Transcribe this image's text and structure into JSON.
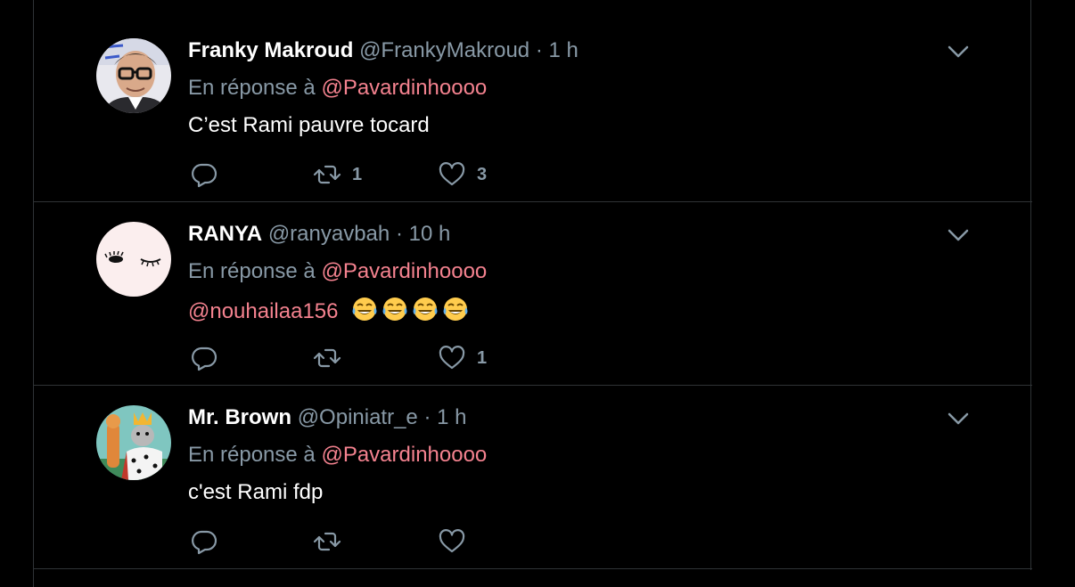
{
  "reply_prefix": "En réponse à",
  "tweets": [
    {
      "name": "Franky Makroud",
      "handle": "@FrankyMakroud",
      "dot": "·",
      "time": "1 h",
      "reply_to": "@Pavardinhoooo",
      "text": "C’est Rami pauvre tocard",
      "text_mention": "",
      "retweets": "1",
      "likes": "3",
      "avatar": "man-glasses-avatar"
    },
    {
      "name": "RANYA",
      "handle": "@ranyavbah",
      "dot": "·",
      "time": "10 h",
      "reply_to": "@Pavardinhoooo",
      "text": "",
      "text_mention": "@nouhailaa156",
      "emojis": [
        "face-with-tears-of-joy",
        "face-with-tears-of-joy",
        "face-with-tears-of-joy",
        "face-with-tears-of-joy"
      ],
      "retweets": "",
      "likes": "1",
      "avatar": "eyes-drawing-avatar"
    },
    {
      "name": "Mr. Brown",
      "handle": "@Opiniatr_e",
      "dot": "·",
      "time": "1 h",
      "reply_to": "@Pavardinhoooo",
      "text": "c'est Rami fdp",
      "text_mention": "",
      "retweets": "",
      "likes": "",
      "avatar": "cartoon-king-avatar"
    }
  ],
  "colors": {
    "background": "#000000",
    "name": "#ffffff",
    "muted": "#8899a6",
    "mention": "#f4828f",
    "divider": "#2f3336"
  }
}
